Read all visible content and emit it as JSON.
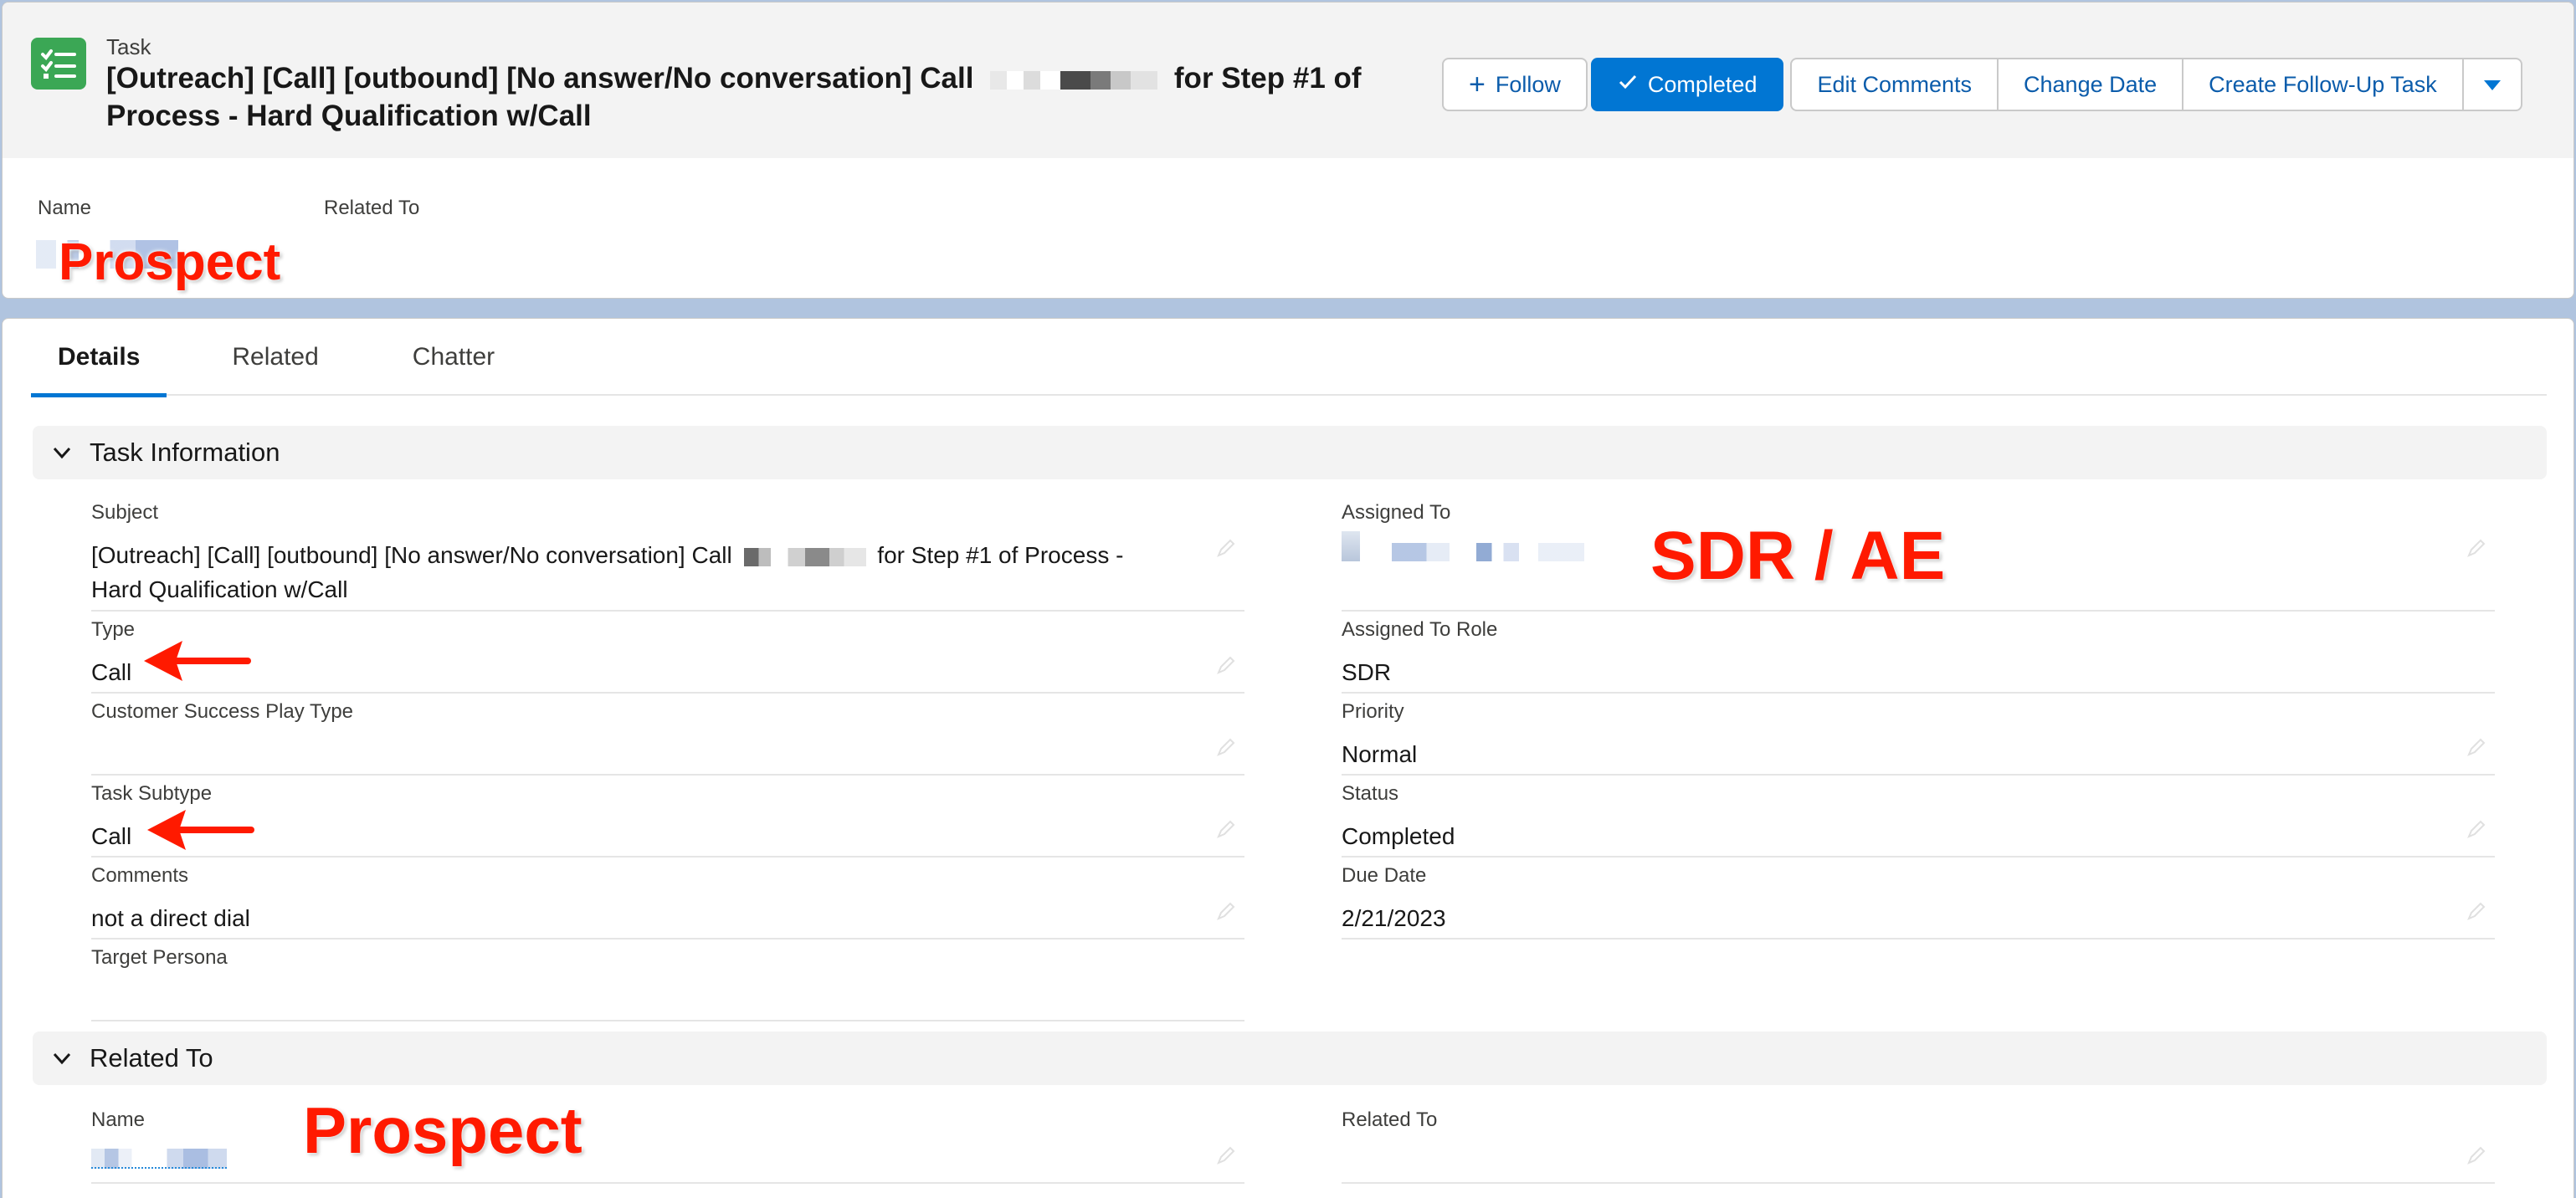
{
  "header": {
    "object_label": "Task",
    "title_part1": "[Outreach] [Call] [outbound] [No answer/No conversation] Call",
    "title_part2": "for Step #1 of",
    "title_line2": "Process - Hard Qualification w/Call",
    "task_icon": "task-checklist-icon",
    "actions": {
      "follow": "Follow",
      "completed": "Completed",
      "edit_comments": "Edit Comments",
      "change_date": "Change Date",
      "create_follow_up": "Create Follow-Up Task"
    }
  },
  "highlights": {
    "name_label": "Name",
    "related_to_label": "Related To"
  },
  "annotations": {
    "prospect_top": "Prospect",
    "sdr_ae": "SDR / AE",
    "prospect_bottom": "Prospect"
  },
  "tabs": [
    "Details",
    "Related",
    "Chatter"
  ],
  "task_information": {
    "section_title": "Task Information",
    "left": {
      "subject": {
        "label": "Subject",
        "value_part1": "[Outreach] [Call] [outbound] [No answer/No conversation] Call",
        "value_part2": "for Step #1 of Process -",
        "value_line2": "Hard Qualification w/Call"
      },
      "type": {
        "label": "Type",
        "value": "Call"
      },
      "cs_play_type": {
        "label": "Customer Success Play Type",
        "value": ""
      },
      "task_subtype": {
        "label": "Task Subtype",
        "value": "Call"
      },
      "comments": {
        "label": "Comments",
        "value": "not a direct dial"
      },
      "target_persona": {
        "label": "Target Persona",
        "value": ""
      }
    },
    "right": {
      "assigned_to": {
        "label": "Assigned To"
      },
      "assigned_to_role": {
        "label": "Assigned To Role",
        "value": "SDR"
      },
      "priority": {
        "label": "Priority",
        "value": "Normal"
      },
      "status": {
        "label": "Status",
        "value": "Completed"
      },
      "due_date": {
        "label": "Due Date",
        "value": "2/21/2023"
      }
    }
  },
  "related_to_section": {
    "section_title": "Related To",
    "name_label": "Name",
    "related_to_label": "Related To"
  },
  "colors": {
    "brand": "#0176d3",
    "task_icon_bg": "#3ba755",
    "annotation_red": "#ff1a00",
    "page_bg": "#b0c4df"
  }
}
